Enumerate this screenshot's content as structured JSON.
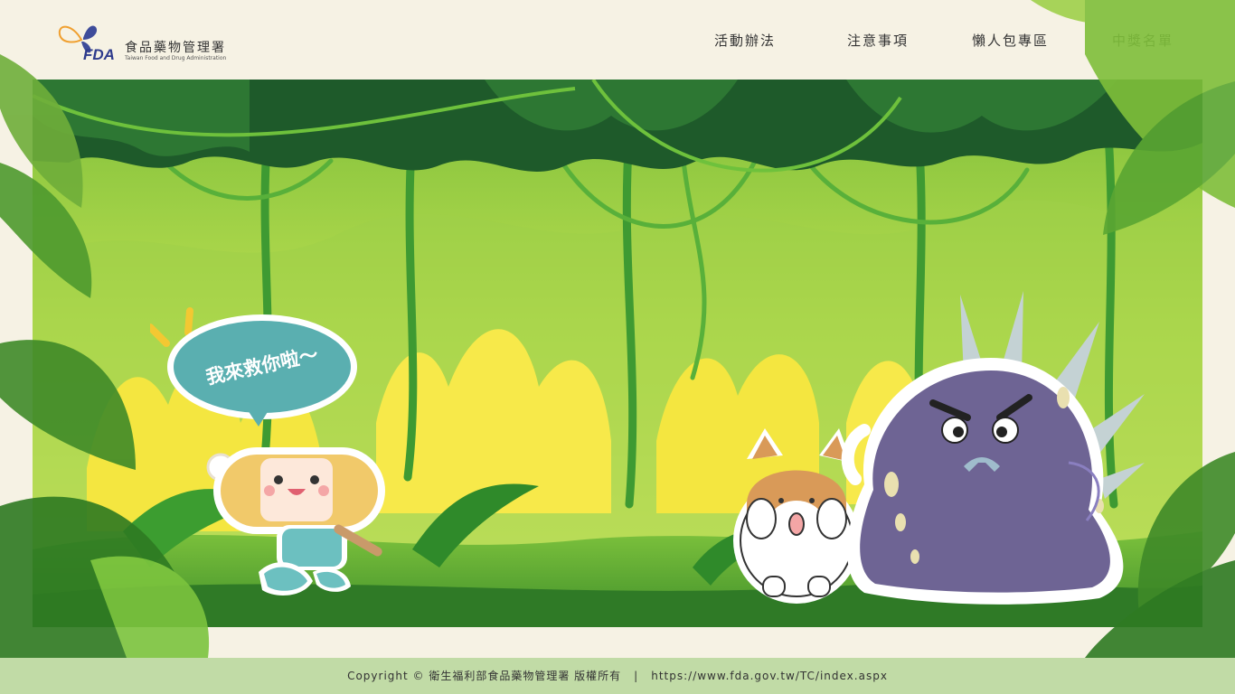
{
  "header": {
    "logo": {
      "mark": "FDA",
      "name": "食品藥物管理署",
      "english": "Taiwan Food and Drug Administration"
    },
    "nav": [
      {
        "label": "活動辦法"
      },
      {
        "label": "注意事項"
      },
      {
        "label": "懶人包專區"
      },
      {
        "label": "中獎名單"
      }
    ]
  },
  "banner": {
    "speech_bubble": "我來救你啦～",
    "characters": [
      "bandage-hero",
      "shiba-dog",
      "purple-germ-monster"
    ]
  },
  "footer": {
    "copyright": "Copyright © 衛生福利部食品藥物管理署 版權所有",
    "separator": "|",
    "url": "https://www.fda.gov.tw/TC/index.aspx"
  },
  "colors": {
    "page_background": "#f6f2e4",
    "footer_background": "#c1dba6",
    "jungle_dark": "#1e5a2a",
    "jungle_light": "#b8dc48",
    "bubble": "#5aafb0",
    "monster": "#6e6494"
  }
}
